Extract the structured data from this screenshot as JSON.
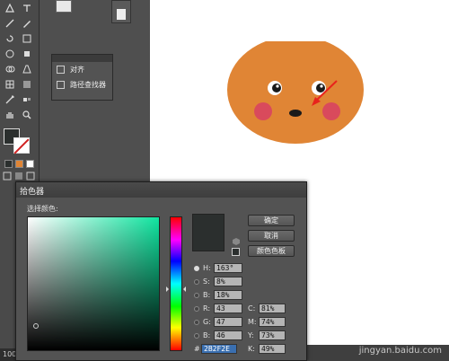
{
  "app": {
    "zoom_fragment": "100"
  },
  "align_panel": {
    "items": [
      {
        "label": "对齐"
      },
      {
        "label": "路径查找器"
      }
    ]
  },
  "color_picker": {
    "title": "拾色器",
    "select_color_label": "选择颜色:",
    "buttons": {
      "ok": "确定",
      "cancel": "取消",
      "swatches": "颜色色板"
    },
    "fields": {
      "H": {
        "label": "H:",
        "value": "163°",
        "selected": true
      },
      "S": {
        "label": "S:",
        "value": "8%"
      },
      "B": {
        "label": "B:",
        "value": "18%"
      },
      "R": {
        "label": "R:",
        "value": "43"
      },
      "G": {
        "label": "G:",
        "value": "47"
      },
      "Bl": {
        "label": "B:",
        "value": "46"
      },
      "C": {
        "label": "C:",
        "value": "81%"
      },
      "M": {
        "label": "M:",
        "value": "74%"
      },
      "Y": {
        "label": "Y:",
        "value": "73%"
      },
      "K": {
        "label": "K:",
        "value": "49%"
      },
      "hex": {
        "label": "#",
        "value": "2B2F2E"
      }
    },
    "current_color": "#2b2f2e"
  },
  "artwork": {
    "face_color": "#e08535",
    "cheek_color": "#d94a5c",
    "arrow_color": "#e8231c"
  },
  "watermark": {
    "text": "jingyan.baidu.com"
  },
  "colors": {
    "toolbar_bg": "#4a4a4a",
    "panel_bg": "#535353",
    "canvas_bg": "#ffffff"
  }
}
